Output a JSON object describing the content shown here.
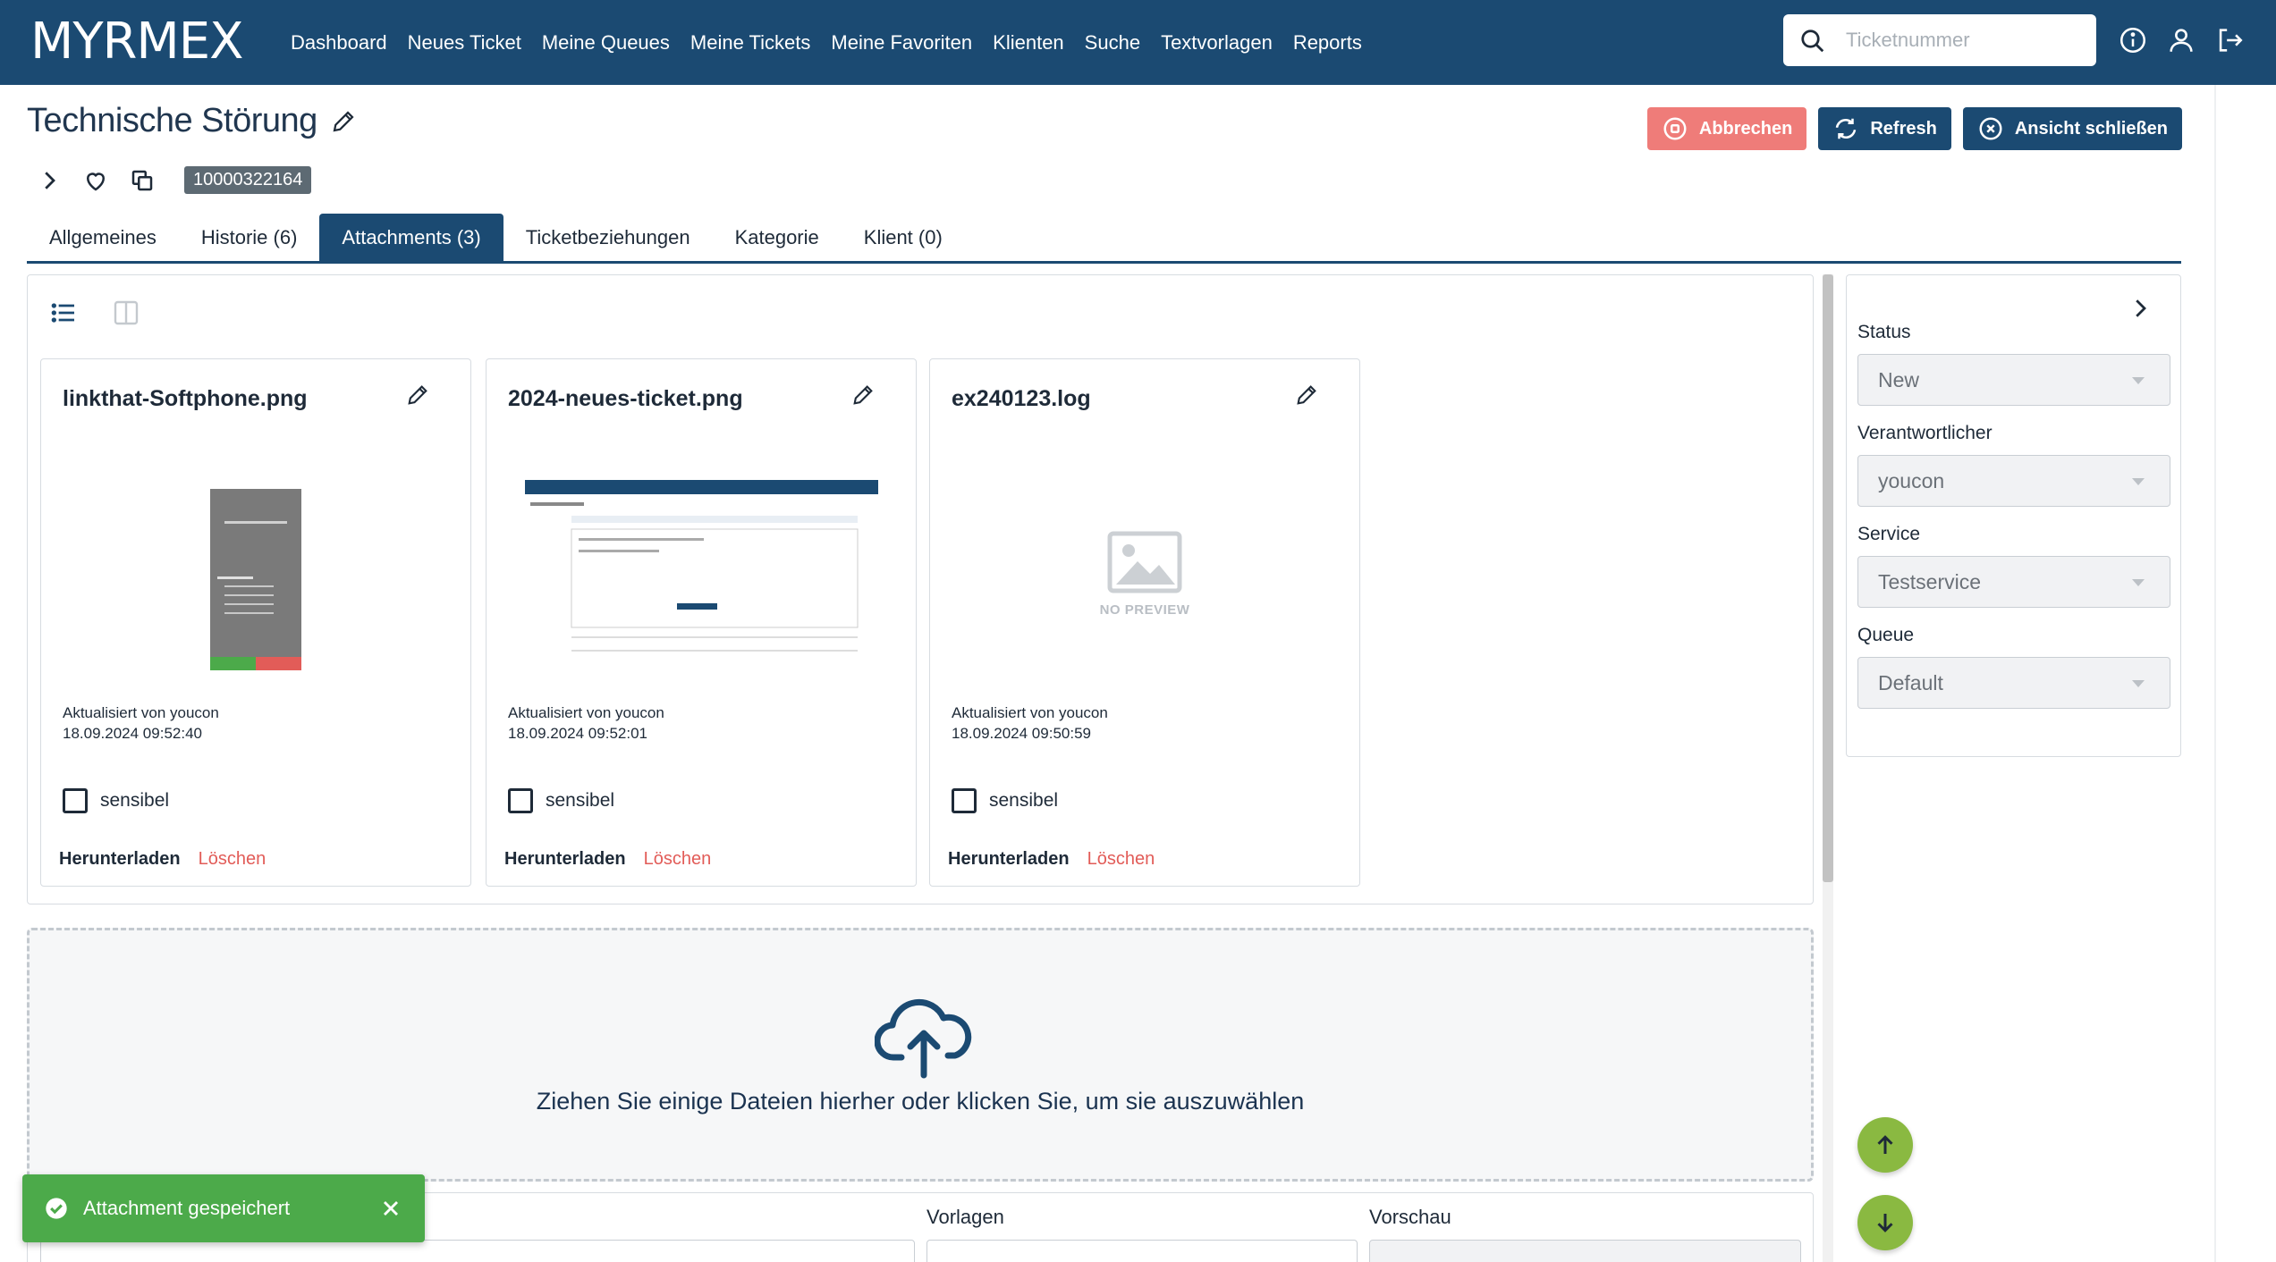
{
  "app": {
    "logo": "MYRMEX"
  },
  "nav": {
    "items": [
      "Dashboard",
      "Neues Ticket",
      "Meine Queues",
      "Meine Tickets",
      "Meine Favoriten",
      "Klienten",
      "Suche",
      "Textvorlagen",
      "Reports"
    ]
  },
  "search": {
    "placeholder": "Ticketnummer"
  },
  "ticket": {
    "title": "Technische Störung",
    "number": "10000322164"
  },
  "header_buttons": {
    "cancel": "Abbrechen",
    "refresh": "Refresh",
    "close_view": "Ansicht schließen"
  },
  "tabs": [
    {
      "label": "Allgemeines",
      "active": false
    },
    {
      "label": "Historie (6)",
      "active": false
    },
    {
      "label": "Attachments (3)",
      "active": true
    },
    {
      "label": "Ticketbeziehungen",
      "active": false
    },
    {
      "label": "Kategorie",
      "active": false
    },
    {
      "label": "Klient (0)",
      "active": false
    }
  ],
  "attachments": [
    {
      "filename": "linkthat-Softphone.png",
      "updated_by": "Aktualisiert von youcon",
      "updated_at": "18.09.2024 09:52:40",
      "sensitive_label": "sensibel",
      "download": "Herunterladen",
      "delete": "Löschen",
      "preview": "phone-screenshot"
    },
    {
      "filename": "2024-neues-ticket.png",
      "updated_by": "Aktualisiert von youcon",
      "updated_at": "18.09.2024 09:52:01",
      "sensitive_label": "sensibel",
      "download": "Herunterladen",
      "delete": "Löschen",
      "preview": "ticket-screenshot"
    },
    {
      "filename": "ex240123.log",
      "updated_by": "Aktualisiert von youcon",
      "updated_at": "18.09.2024 09:50:59",
      "sensitive_label": "sensibel",
      "download": "Herunterladen",
      "delete": "Löschen",
      "preview": "none",
      "no_preview_label": "NO PREVIEW"
    }
  ],
  "dropzone": {
    "text": "Ziehen Sie einige Dateien hierher oder klicken Sie, um sie auszuwählen"
  },
  "bottom": {
    "templates_label": "Vorlagen",
    "preview_label": "Vorschau"
  },
  "side_panel": {
    "fields": [
      {
        "label": "Status",
        "value": "New"
      },
      {
        "label": "Verantwortlicher",
        "value": "youcon"
      },
      {
        "label": "Service",
        "value": "Testservice"
      },
      {
        "label": "Queue",
        "value": "Default"
      }
    ]
  },
  "toast": {
    "message": "Attachment gespeichert"
  },
  "colors": {
    "brand": "#1b4a72",
    "danger": "#ef7c79",
    "success": "#4caa4a",
    "fab": "#8ab941"
  }
}
